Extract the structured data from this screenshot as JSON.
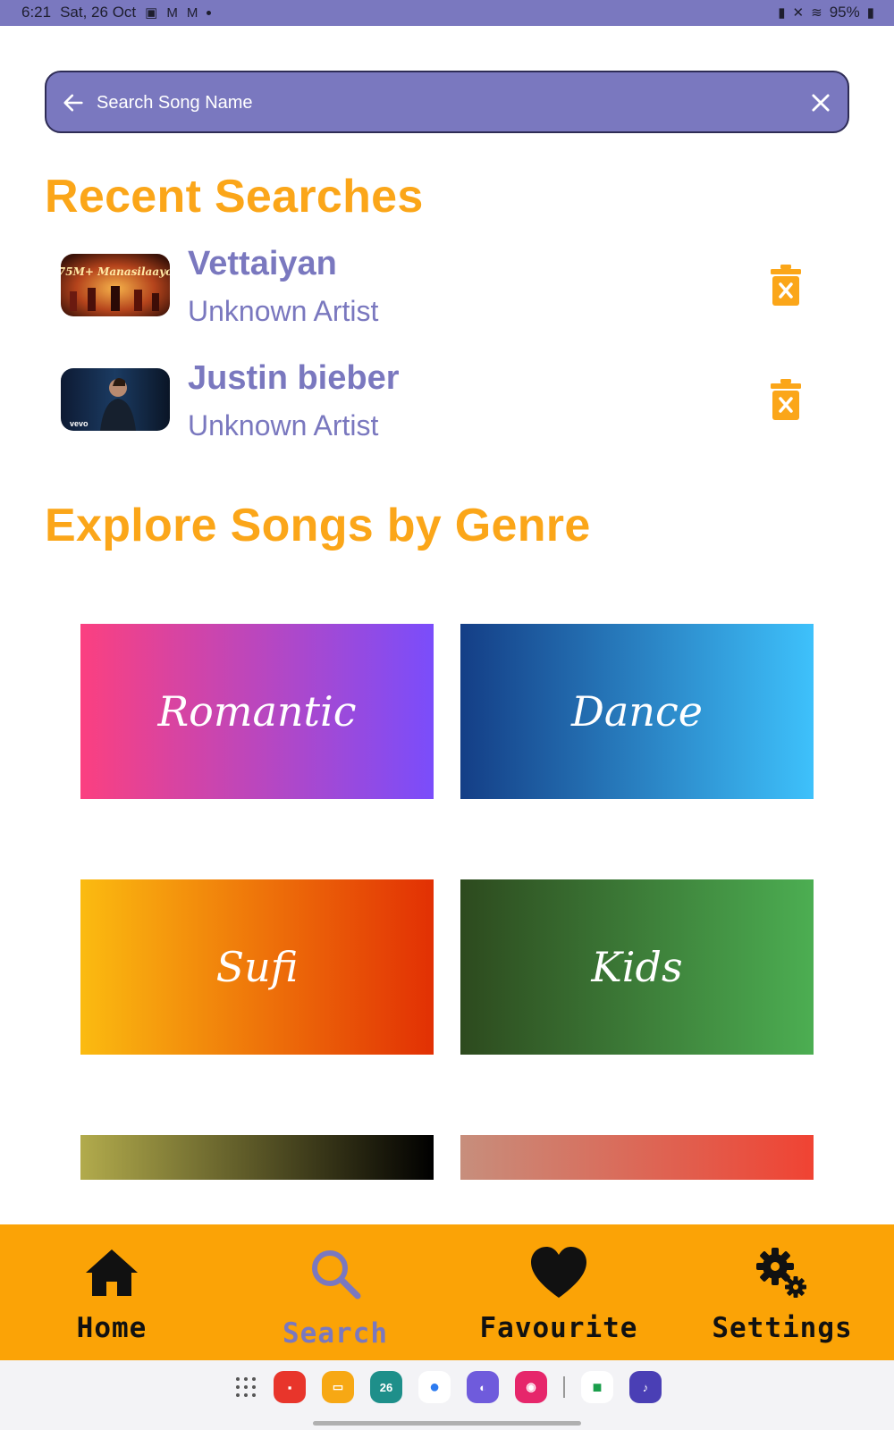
{
  "status_bar": {
    "time": "6:21",
    "date": "Sat, 26 Oct",
    "battery": "95%"
  },
  "search": {
    "placeholder": "Search Song Name"
  },
  "recent": {
    "heading": "Recent Searches",
    "items": [
      {
        "title": "Vettaiyan",
        "artist": "Unknown Artist",
        "thumb_text": "75M+ Manasilaayo"
      },
      {
        "title": "Justin bieber",
        "artist": "Unknown Artist",
        "thumb_text": "vevo"
      }
    ]
  },
  "genres": {
    "heading": "Explore Songs by Genre",
    "items": [
      "Romantic",
      "Dance",
      "Sufi",
      "Kids",
      "",
      ""
    ]
  },
  "nav": {
    "items": [
      {
        "label": "Home",
        "icon": "home-icon"
      },
      {
        "label": "Search",
        "icon": "search-icon",
        "active": true
      },
      {
        "label": "Favourite",
        "icon": "heart-icon"
      },
      {
        "label": "Settings",
        "icon": "gears-icon"
      }
    ]
  },
  "dock": {
    "calendar_day": "26"
  },
  "colors": {
    "primary": "#7a78bf",
    "accent": "#fba619",
    "nav_bg": "#fba306"
  }
}
